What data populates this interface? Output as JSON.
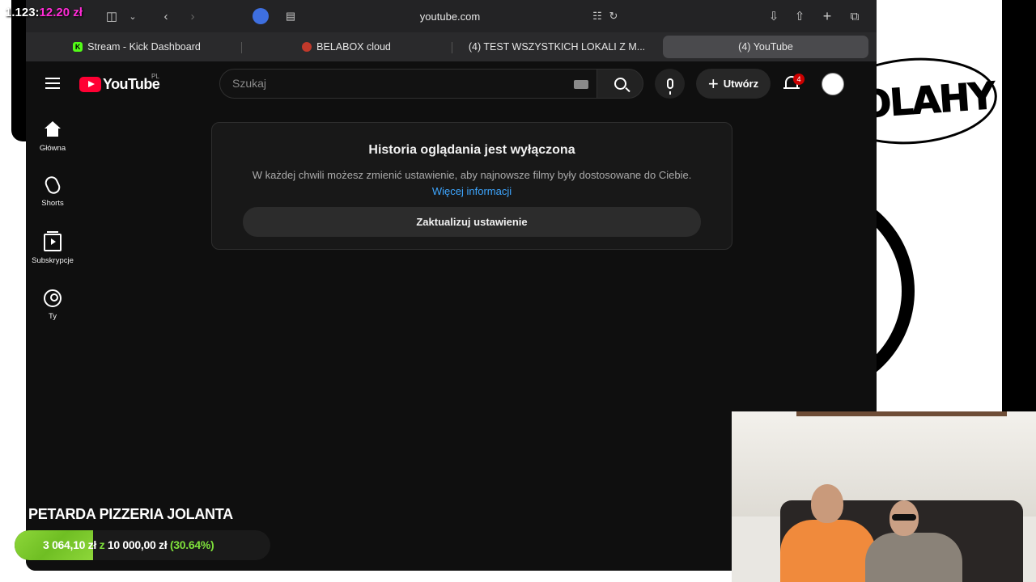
{
  "overlay": {
    "counter_white": "1.123:",
    "counter_pink": "12.20 zł",
    "stream_title": "PETARDA PIZZERIA JOLANTA",
    "goal": {
      "current": "3 064,10 zł",
      "separator": "z",
      "target": "10 000,00 zł",
      "percent_text": "(30.64%)",
      "progress": 0.3064
    },
    "logo_text": "DOLAHY"
  },
  "browser": {
    "url": "youtube.com",
    "tabs": [
      {
        "label": "Stream - Kick Dashboard",
        "favicon": "kick-icon",
        "active": false
      },
      {
        "label": "BELABOX cloud",
        "favicon": "belabox-icon",
        "active": false
      },
      {
        "label": "(4) TEST WSZYSTKICH LOKALI Z M...",
        "favicon": "youtube-icon",
        "active": false
      },
      {
        "label": "(4) YouTube",
        "favicon": "youtube-icon",
        "active": true
      }
    ]
  },
  "youtube": {
    "logo_text": "YouTube",
    "country_code": "PL",
    "search_placeholder": "Szukaj",
    "create_label": "Utwórz",
    "notification_count": "4",
    "sidebar": [
      {
        "label": "Główna",
        "icon": "home-icon"
      },
      {
        "label": "Shorts",
        "icon": "shorts-icon"
      },
      {
        "label": "Subskrypcje",
        "icon": "subscriptions-icon"
      },
      {
        "label": "Ty",
        "icon": "you-icon"
      }
    ],
    "history_card": {
      "title": "Historia oglądania jest wyłączona",
      "text": "W każdej chwili możesz zmienić ustawienie, aby najnowsze filmy były dostosowane do Ciebie.",
      "link": "Więcej informacji",
      "button": "Zaktualizuj ustawienie"
    }
  },
  "colors": {
    "yt_background": "#0f0f0f",
    "yt_red": "#ff0033",
    "link_blue": "#3ea6ff",
    "goal_green": "#7ee03b",
    "counter_pink": "#ff2bd6",
    "kick_green": "#53fc18"
  }
}
